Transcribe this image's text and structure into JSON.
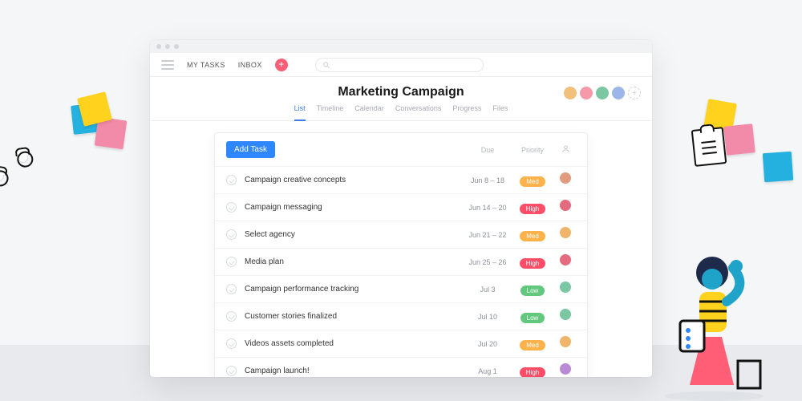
{
  "nav": {
    "my_tasks": "MY TASKS",
    "inbox": "INBOX"
  },
  "project": {
    "title": "Marketing Campaign",
    "tabs": [
      "List",
      "Timeline",
      "Calendar",
      "Conversations",
      "Progress",
      "Files"
    ],
    "active_tab": "List"
  },
  "members": [
    {
      "color": "#f2c07a"
    },
    {
      "color": "#f49aa8"
    },
    {
      "color": "#7bc6a3"
    },
    {
      "color": "#9cb6ea"
    }
  ],
  "list": {
    "add_task_label": "Add Task",
    "columns": {
      "due": "Due",
      "priority": "Priority"
    },
    "priority_labels": {
      "med": "Med",
      "high": "High",
      "low": "Low"
    },
    "tasks": [
      {
        "name": "Campaign creative concepts",
        "due": "Jun 8 – 18",
        "priority": "med",
        "assignee_color": "#e19b7e"
      },
      {
        "name": "Campaign messaging",
        "due": "Jun 14 – 20",
        "priority": "high",
        "assignee_color": "#e46a7d"
      },
      {
        "name": "Select agency",
        "due": "Jun 21 – 22",
        "priority": "med",
        "assignee_color": "#f0b46a"
      },
      {
        "name": "Media plan",
        "due": "Jun 25 – 26",
        "priority": "high",
        "assignee_color": "#e46a7d"
      },
      {
        "name": "Campaign performance tracking",
        "due": "Jul 3",
        "priority": "low",
        "assignee_color": "#7bc6a3"
      },
      {
        "name": "Customer stories finalized",
        "due": "Jul 10",
        "priority": "low",
        "assignee_color": "#7bc6a3"
      },
      {
        "name": "Videos assets completed",
        "due": "Jul 20",
        "priority": "med",
        "assignee_color": "#f0b46a"
      },
      {
        "name": "Campaign launch!",
        "due": "Aug 1",
        "priority": "high",
        "assignee_color": "#b98bd6"
      }
    ]
  }
}
